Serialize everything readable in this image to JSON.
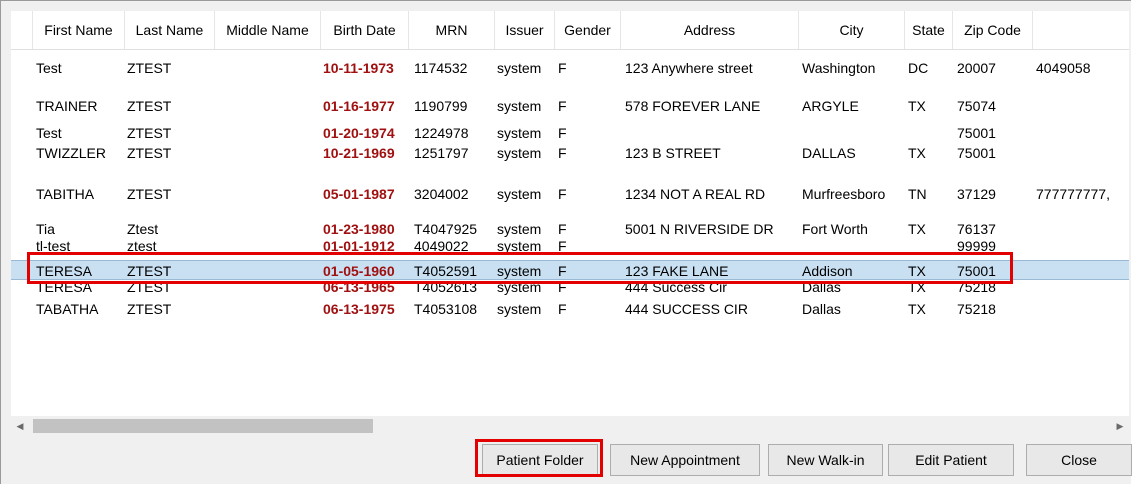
{
  "columns": [
    "First Name",
    "Last Name",
    "Middle Name",
    "Birth Date",
    "MRN",
    "Issuer",
    "Gender",
    "Address",
    "City",
    "State",
    "Zip Code"
  ],
  "rows": [
    {
      "first": "Test",
      "last": "ZTEST",
      "middle": "",
      "birth": "10-11-1973",
      "mrn": "1174532",
      "issuer": "system",
      "gender": "F",
      "address": "123 Anywhere street",
      "city": "Washington",
      "state": "DC",
      "zip": "20007",
      "extra": "4049058"
    },
    {
      "first": "TRAINER",
      "last": "ZTEST",
      "middle": "",
      "birth": "01-16-1977",
      "mrn": "1190799",
      "issuer": "system",
      "gender": "F",
      "address": "578 FOREVER LANE",
      "city": "ARGYLE",
      "state": "TX",
      "zip": "75074",
      "extra": ""
    },
    {
      "first": "Test",
      "last": "ZTEST",
      "middle": "",
      "birth": "01-20-1974",
      "mrn": "1224978",
      "issuer": "system",
      "gender": "F",
      "address": "",
      "city": "",
      "state": "",
      "zip": "75001",
      "extra": ""
    },
    {
      "first": "TWIZZLER",
      "last": "ZTEST",
      "middle": "",
      "birth": "10-21-1969",
      "mrn": "1251797",
      "issuer": "system",
      "gender": "F",
      "address": "123 B STREET",
      "city": "DALLAS",
      "state": "TX",
      "zip": "75001",
      "extra": ""
    },
    {
      "first": "TABITHA",
      "last": "ZTEST",
      "middle": "",
      "birth": "05-01-1987",
      "mrn": "3204002",
      "issuer": "system",
      "gender": "F",
      "address": "1234 NOT A REAL RD",
      "city": "Murfreesboro",
      "state": "TN",
      "zip": "37129",
      "extra": "777777777,"
    },
    {
      "first": "Tia",
      "last": "Ztest",
      "middle": "",
      "birth": "01-23-1980",
      "mrn": "T4047925",
      "issuer": "system",
      "gender": "F",
      "address": "5001 N RIVERSIDE DR",
      "city": "Fort Worth",
      "state": "TX",
      "zip": "76137",
      "extra": ""
    },
    {
      "first": "tl-test",
      "last": "ztest",
      "middle": "",
      "birth": "01-01-1912",
      "mrn": "4049022",
      "issuer": "system",
      "gender": "F",
      "address": "",
      "city": "",
      "state": "",
      "zip": "99999",
      "extra": ""
    },
    {
      "first": "TERESA",
      "last": "ZTEST",
      "middle": "",
      "birth": "01-05-1960",
      "mrn": "T4052591",
      "issuer": "system",
      "gender": "F",
      "address": "123 FAKE LANE",
      "city": "Addison",
      "state": "TX",
      "zip": "75001",
      "extra": ""
    },
    {
      "first": "TERESA",
      "last": "ZTEST",
      "middle": "",
      "birth": "06-13-1965",
      "mrn": "T4052613",
      "issuer": "system",
      "gender": "F",
      "address": "444 Success Cir",
      "city": "Dallas",
      "state": "TX",
      "zip": "75218",
      "extra": ""
    },
    {
      "first": "TABATHA",
      "last": "ZTEST",
      "middle": "",
      "birth": "06-13-1975",
      "mrn": "T4053108",
      "issuer": "system",
      "gender": "F",
      "address": "444 SUCCESS CIR",
      "city": "Dallas",
      "state": "TX",
      "zip": "75218",
      "extra": ""
    }
  ],
  "selected_row": 7,
  "buttons": {
    "patient_folder": "Patient Folder",
    "new_appointment": "New Appointment",
    "new_walkin": "New Walk-in",
    "edit_patient": "Edit Patient",
    "close": "Close"
  },
  "icons": {
    "scroll_left": "triangle-left-icon",
    "scroll_right": "triangle-right-icon"
  },
  "colors": {
    "birth_date": "#a01010",
    "selection": "#c9e0f2",
    "highlight_box": "#e30000"
  }
}
